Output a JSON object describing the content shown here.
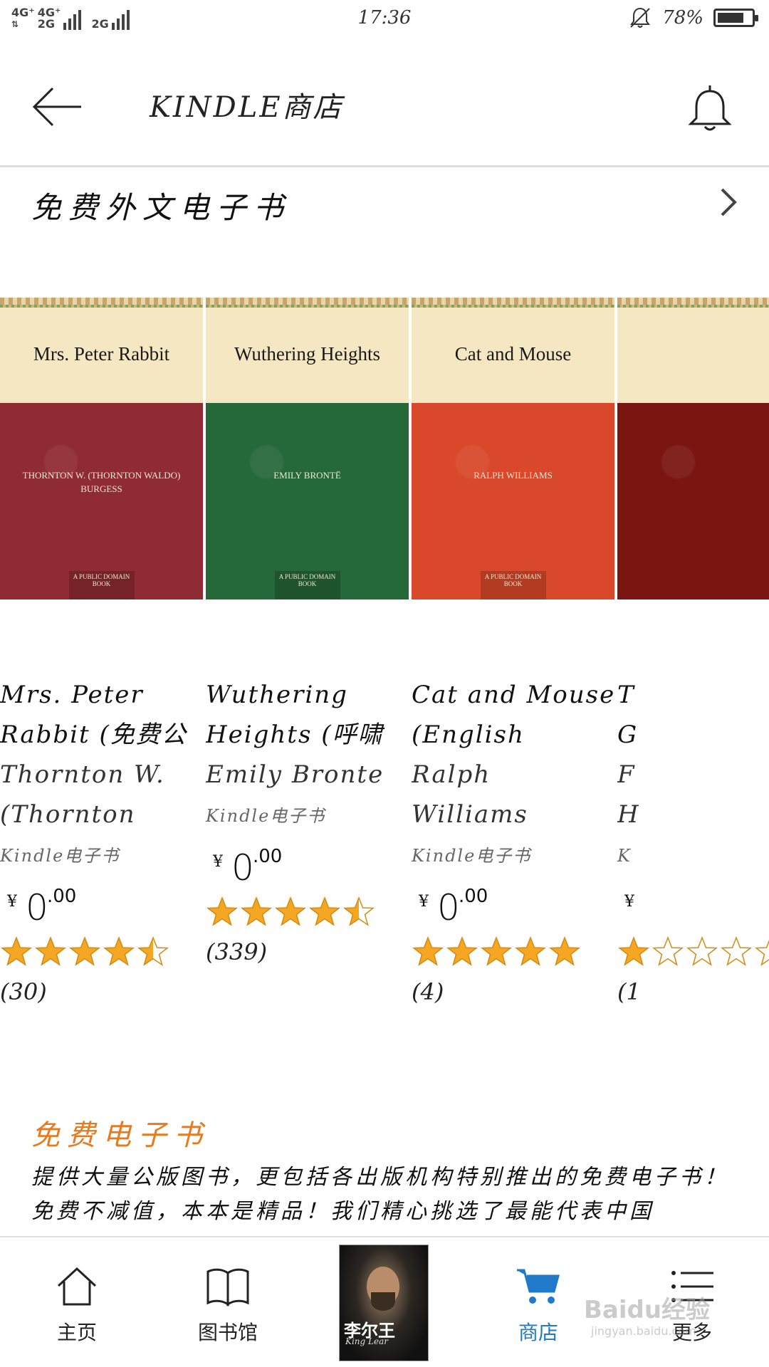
{
  "status_bar": {
    "signal1": "4G⁺",
    "signal2": "4G⁺",
    "signal3": "2G",
    "signal4": "2G",
    "time": "17:36",
    "battery_text": "78%",
    "battery_level": 0.78
  },
  "header": {
    "title": "KINDLE商店"
  },
  "section": {
    "title": "免费外文电子书"
  },
  "books": [
    {
      "cover_title": "Mrs. Peter Rabbit",
      "cover_author": "THORNTON W. (THORNTON WALDO) BURGESS",
      "cover_badge": "A PUBLIC DOMAIN BOOK",
      "cover_color": "#8f2b32",
      "title_line1": "Mrs. Peter",
      "title_line2": "Rabbit (免费公",
      "author_line1": "Thornton W.",
      "author_line2": "(Thornton",
      "format": "Kindle电子书",
      "price_currency": "¥",
      "price_int": "0",
      "price_dec": ".00",
      "rating": 4.5,
      "reviews": "(30)"
    },
    {
      "cover_title": "Wuthering Heights",
      "cover_author": "EMILY BRONTË",
      "cover_badge": "A PUBLIC DOMAIN BOOK",
      "cover_color": "#25683a",
      "title_line1": "Wuthering",
      "title_line2": "Heights (呼啸",
      "author_line1": "Emily Bronte",
      "author_line2": "",
      "format": "Kindle电子书",
      "price_currency": "¥",
      "price_int": "0",
      "price_dec": ".00",
      "rating": 4.5,
      "reviews": "(339)"
    },
    {
      "cover_title": "Cat and Mouse",
      "cover_author": "RALPH WILLIAMS",
      "cover_badge": "A PUBLIC DOMAIN BOOK",
      "cover_color": "#d9482a",
      "title_line1": "Cat and Mouse",
      "title_line2": "(English",
      "author_line1": "Ralph",
      "author_line2": "Williams",
      "format": "Kindle电子书",
      "price_currency": "¥",
      "price_int": "0",
      "price_dec": ".00",
      "rating": 5,
      "reviews": "(4)"
    },
    {
      "cover_title": "",
      "cover_author": "",
      "cover_badge": "",
      "cover_color": "#7a1512",
      "title_line1": "T",
      "title_line2": "G",
      "author_line1": "F",
      "author_line2": "H",
      "format": "K",
      "price_currency": "¥",
      "price_int": "",
      "price_dec": "",
      "rating": 1,
      "reviews": "(1"
    }
  ],
  "free_section": {
    "title": "免费电子书",
    "description": "提供大量公版图书，更包括各出版机构特别推出的免费电子书！免费不减值，本本是精品！我们精心挑选了最能代表中国"
  },
  "now_reading": {
    "cover_title_cn": "李尔王",
    "cover_title_en": "King Lear"
  },
  "bottom_nav": {
    "home": "主页",
    "library": "图书馆",
    "store": "商店",
    "more": "更多"
  },
  "colors": {
    "accent": "#1f7ac9",
    "section_orange": "#e8791c",
    "star": "#f5a623"
  },
  "watermark": {
    "text": "Baidu经验",
    "sub": "jingyan.baidu.com"
  }
}
